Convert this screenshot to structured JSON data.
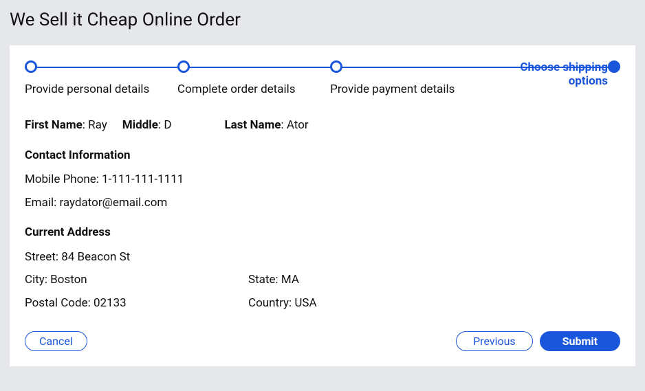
{
  "page": {
    "title": "We Sell it Cheap Online Order"
  },
  "stepper": {
    "steps": [
      {
        "label": "Provide personal details",
        "active": false,
        "filled": false
      },
      {
        "label": "Complete order details",
        "active": false,
        "filled": false
      },
      {
        "label": "Provide payment details",
        "active": false,
        "filled": false
      },
      {
        "label": "Choose shipping options",
        "active": true,
        "filled": true
      }
    ]
  },
  "name": {
    "first_label": "First Name",
    "first_value": "Ray",
    "middle_label": "Middle",
    "middle_value": "D",
    "last_label": "Last Name",
    "last_value": "Ator"
  },
  "contact": {
    "section_title": "Contact Information",
    "mobile_label": "Mobile Phone",
    "mobile_value": "1-111-111-1111",
    "email_label": "Email",
    "email_value": "raydator@email.com"
  },
  "address": {
    "section_title": "Current Address",
    "street_label": "Street",
    "street_value": "84 Beacon St",
    "city_label": "City",
    "city_value": "Boston",
    "state_label": "State",
    "state_value": "MA",
    "postal_label": "Postal Code",
    "postal_value": "02133",
    "country_label": "Country",
    "country_value": "USA"
  },
  "buttons": {
    "cancel": "Cancel",
    "previous": "Previous",
    "submit": "Submit"
  }
}
